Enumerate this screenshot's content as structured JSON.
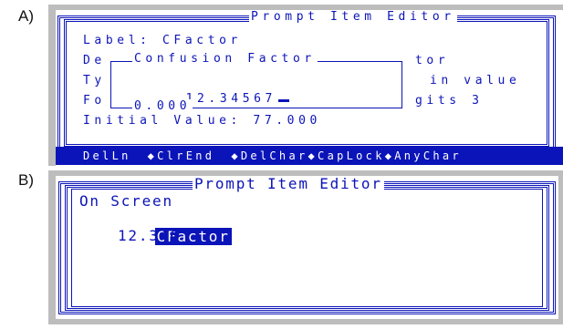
{
  "panels": [
    {
      "label": "A)"
    },
    {
      "label": "B)"
    }
  ],
  "editor_a": {
    "title": "Prompt Item Editor",
    "label_line": "Label: CFactor",
    "desc_prefix": "De",
    "desc_suffix": "tor",
    "type_prefix": "Ty",
    "type_suffix": "in value",
    "format_prefix": "Fo",
    "format_suffix": "gits 3",
    "initial_value": "Initial Value: 77.000",
    "popup": {
      "title": "Confusion Factor",
      "value": "12.34567",
      "bottom_value": "0.000"
    },
    "menu": [
      "DelLn",
      "◆ClrEnd",
      "◆DelChar",
      "◆CapLock",
      "◆AnyChar"
    ]
  },
  "editor_b": {
    "title": "Prompt Item Editor",
    "heading": "On Screen",
    "selected_item": "CFactor",
    "value": "12.346"
  },
  "colors": {
    "screen_blue": "#0b14b8",
    "frame_gray": "#bdbdbd",
    "background": "#ffffff"
  }
}
